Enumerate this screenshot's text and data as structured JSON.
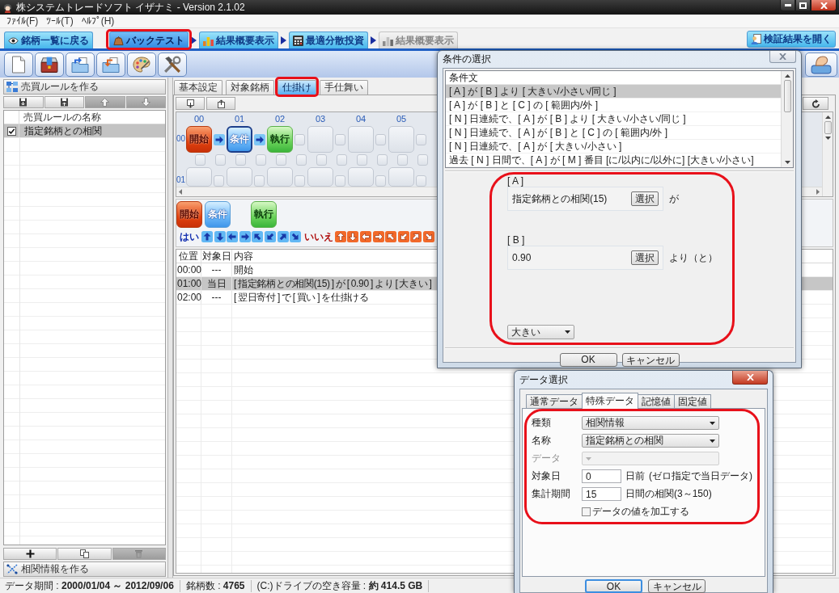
{
  "window": {
    "title": "株システムトレードソフト イザナミ - Version 2.1.02"
  },
  "menu": [
    "ﾌｧｲﾙ(F)",
    "ﾂｰﾙ(T)",
    "ﾍﾙﾌﾟ(H)"
  ],
  "workflow_tabs": [
    {
      "kind": "back",
      "label": "銘柄一覧に戻る",
      "selected": false,
      "disabled": false,
      "highlighted": false
    },
    {
      "kind": "step",
      "label": "バックテスト",
      "selected": true,
      "disabled": false,
      "highlighted": true
    },
    {
      "kind": "step",
      "label": "結果概要表示",
      "selected": false,
      "disabled": false,
      "highlighted": false
    },
    {
      "kind": "step",
      "label": "最適分散投資",
      "selected": false,
      "disabled": false,
      "highlighted": false
    },
    {
      "kind": "step",
      "label": "結果概要表示",
      "selected": false,
      "disabled": true,
      "highlighted": false
    }
  ],
  "open_results_button": "検証結果を開く",
  "rule_panel": {
    "title": "売買ルールを作る",
    "toolbar": [
      {
        "disabled": false
      },
      {
        "disabled": false
      },
      {
        "disabled": true
      },
      {
        "disabled": true
      }
    ],
    "column": "売買ルールの名称",
    "rules": [
      {
        "name": "指定銘柄との相関",
        "checked": true,
        "selected": true
      }
    ],
    "bottom_toolbar": [
      {
        "disabled": false
      },
      {
        "disabled": false
      },
      {
        "disabled": true
      }
    ],
    "create_button": "相関情報を作る"
  },
  "sub_tabs": [
    {
      "label": "基本設定",
      "selected": false,
      "highlighted": false
    },
    {
      "label": "対象銘柄",
      "selected": false,
      "highlighted": false
    },
    {
      "label": "仕掛け",
      "selected": true,
      "highlighted": true
    },
    {
      "label": "手仕舞い",
      "selected": false,
      "highlighted": false
    }
  ],
  "flow_grid": {
    "column_labels": [
      "00",
      "01",
      "02",
      "03",
      "04",
      "05"
    ],
    "row_labels": [
      "00",
      "01"
    ],
    "nodes": [
      {
        "kind": "start",
        "label": "開始",
        "selected": false
      },
      {
        "kind": "condition",
        "label": "条件",
        "selected": true
      },
      {
        "kind": "execute",
        "label": "執行",
        "selected": false
      }
    ]
  },
  "palette": {
    "blocks": [
      {
        "kind": "start",
        "label": "開始"
      },
      {
        "kind": "condition",
        "label": "条件"
      },
      {
        "kind": "execute",
        "label": "執行"
      }
    ],
    "yes_label": "はい",
    "no_label": "いいえ"
  },
  "steps_table": {
    "columns": [
      "位置",
      "対象日",
      "内容"
    ],
    "rows": [
      {
        "position": "00:00",
        "day": "---",
        "content": "開始",
        "selected": false
      },
      {
        "position": "01:00",
        "day": "当日",
        "content": "[ 指定銘柄との相関(15) ] が [ 0.90 ] より [ 大きい ]",
        "selected": true
      },
      {
        "position": "02:00",
        "day": "---",
        "content": "[ 翌日寄付 ] で [ 買い ] を仕掛ける",
        "selected": false
      }
    ]
  },
  "status_bar": [
    "データ期間 : **2000/01/04 ～ 2012/09/06**",
    "銘柄数 : **4765**",
    "(C:)ドライブの空き容量 : **約 414.5 GB**"
  ],
  "condition_dialog": {
    "title": "条件の選択",
    "active": false,
    "list_header": "条件文",
    "conditions": [
      {
        "text": "[ A ] が [ B ] より [ 大きい/小さい/同じ ]",
        "selected": true
      },
      {
        "text": "[ A ] が [ B ] と [ C ] の [ 範囲内/外 ]",
        "selected": false
      },
      {
        "text": "[ N ] 日連続で、[ A ] が [ B ] より [ 大きい/小さい/同じ ]",
        "selected": false
      },
      {
        "text": "[ N ] 日連続で、[ A ] が [ B ] と [ C ] の [ 範囲内/外 ]",
        "selected": false
      },
      {
        "text": "[ N ] 日連続で、[ A ] が [ 大きい/小さい ]",
        "selected": false
      },
      {
        "text": "過去 [ N ] 日間で、[ A ] が [ M ] 番目 [に/以内に/以外に] [大きい/小さい]",
        "selected": false
      }
    ],
    "highlighted": true,
    "operands": [
      {
        "label": "[ A ]",
        "value": "指定銘柄との相関(15)",
        "button": "選択",
        "suffix": "が"
      },
      {
        "label": "[ B ]",
        "value": "0.90",
        "button": "選択",
        "suffix": "より（と）"
      }
    ],
    "comparison": "大きい",
    "buttons": [
      "OK",
      "キャンセル"
    ]
  },
  "data_dialog": {
    "title": "データ選択",
    "active": true,
    "tabs": [
      {
        "label": "通常データ",
        "selected": false
      },
      {
        "label": "特殊データ",
        "selected": true
      },
      {
        "label": "記憶値",
        "selected": false
      },
      {
        "label": "固定値",
        "selected": false
      }
    ],
    "highlighted": true,
    "fields": [
      {
        "kind": "select",
        "label": "種類",
        "value": "相関情報",
        "disabled": false
      },
      {
        "kind": "select",
        "label": "名称",
        "value": "指定銘柄との相関",
        "disabled": false
      },
      {
        "kind": "select",
        "label": "データ",
        "disabled": true
      },
      {
        "kind": "number",
        "label": "対象日",
        "value": "0",
        "unit": "日前",
        "note": "(ゼロ指定で当日データ)",
        "disabled": false
      },
      {
        "kind": "number",
        "label": "集計期間",
        "value": "15",
        "unit": "日間の相関(3～150)",
        "disabled": false
      },
      {
        "kind": "checkbox",
        "label": "データの値を加工する",
        "checked": false,
        "disabled": false
      }
    ],
    "buttons": [
      {
        "label": "OK",
        "focused": true
      },
      {
        "label": "キャンセル",
        "focused": false
      }
    ]
  }
}
